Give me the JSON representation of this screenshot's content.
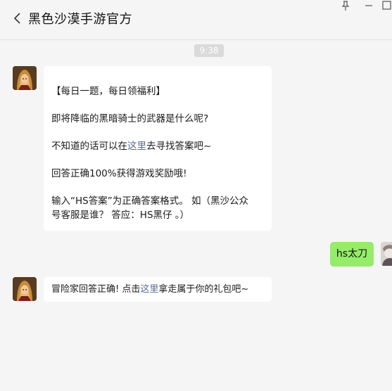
{
  "header": {
    "title": "黑色沙漠手游官方"
  },
  "chat": {
    "timestamp": "9:38",
    "msg1": {
      "line1": "【每日一题，每日领福利】",
      "line2": "即将降临的黑暗骑士的武器是什么呢?",
      "line3_pre": "不知道的话可以在",
      "line3_link": "这里",
      "line3_post": "去寻找答案吧~",
      "line4": "回答正确100%获得游戏奖励哦!",
      "line5a": "输入“HS答案”为正确答案格式。 如（黑沙公众",
      "line5b": "号客服是谁？ 答应：HS黑仔 。）"
    },
    "reply": {
      "text": "hs太刀"
    },
    "msg2": {
      "pre": "冒险家回答正确! 点击",
      "link": "这里",
      "post": "拿走属于你的礼包吧~"
    }
  },
  "colors": {
    "background": "#f5f5f5",
    "bubble_white": "#ffffff",
    "bubble_green": "#95ec69",
    "link": "#576b95",
    "timestamp_bg": "#dadada"
  },
  "icons": {
    "back": "chevron-left-icon",
    "pin": "pin-icon",
    "minimize": "minimize-icon",
    "maximize": "maximize-icon"
  }
}
